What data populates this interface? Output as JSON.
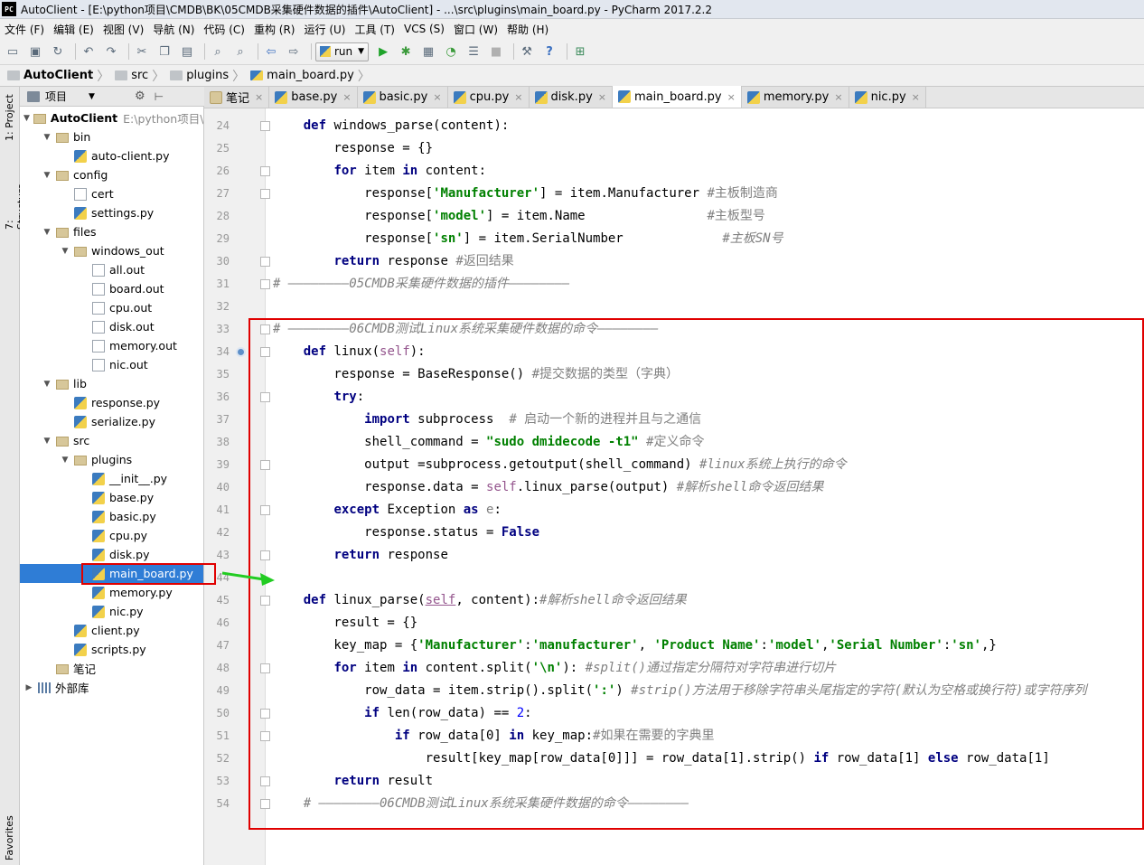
{
  "window": {
    "app_icon": "PC",
    "title": "AutoClient - [E:\\python项目\\CMDB\\BK\\05CMDB采集硬件数据的插件\\AutoClient] - ...\\src\\plugins\\main_board.py - PyCharm 2017.2.2"
  },
  "menu": [
    "文件 (F)",
    "编辑 (E)",
    "视图 (V)",
    "导航 (N)",
    "代码 (C)",
    "重构 (R)",
    "运行 (U)",
    "工具 (T)",
    "VCS (S)",
    "窗口 (W)",
    "帮助 (H)"
  ],
  "toolbar": {
    "run_config": "run",
    "icons": [
      "open-icon",
      "save-icon",
      "sync-icon",
      "undo-icon",
      "redo-icon",
      "cut-icon",
      "copy-icon",
      "paste-icon",
      "find-icon",
      "replace-icon",
      "back-icon",
      "forward-icon",
      "run-icon",
      "debug-icon",
      "coverage-icon",
      "profile-icon",
      "concurrency-icon",
      "stop-icon",
      "settings-icon",
      "help-icon",
      "vcs-icon"
    ]
  },
  "breadcrumb": [
    "AutoClient",
    "src",
    "plugins",
    "main_board.py"
  ],
  "side_tabs": {
    "project": "1: Project",
    "structure": "7: Structure",
    "favorites": "Favorites"
  },
  "project_panel": {
    "title": "项目"
  },
  "tree": [
    {
      "label": "AutoClient",
      "extra": "E:\\python项目\\C",
      "depth": 0,
      "icon": "folder",
      "twisty": "open",
      "bold": true
    },
    {
      "label": "bin",
      "depth": 1,
      "icon": "folder",
      "twisty": "open"
    },
    {
      "label": "auto-client.py",
      "depth": 2,
      "icon": "py"
    },
    {
      "label": "config",
      "depth": 1,
      "icon": "folder",
      "twisty": "open"
    },
    {
      "label": "cert",
      "depth": 2,
      "icon": "file"
    },
    {
      "label": "settings.py",
      "depth": 2,
      "icon": "py"
    },
    {
      "label": "files",
      "depth": 1,
      "icon": "folder",
      "twisty": "open"
    },
    {
      "label": "windows_out",
      "depth": 2,
      "icon": "folder",
      "twisty": "open"
    },
    {
      "label": "all.out",
      "depth": 3,
      "icon": "file"
    },
    {
      "label": "board.out",
      "depth": 3,
      "icon": "file"
    },
    {
      "label": "cpu.out",
      "depth": 3,
      "icon": "file"
    },
    {
      "label": "disk.out",
      "depth": 3,
      "icon": "file"
    },
    {
      "label": "memory.out",
      "depth": 3,
      "icon": "file"
    },
    {
      "label": "nic.out",
      "depth": 3,
      "icon": "file"
    },
    {
      "label": "lib",
      "depth": 1,
      "icon": "folder",
      "twisty": "open"
    },
    {
      "label": "response.py",
      "depth": 2,
      "icon": "py"
    },
    {
      "label": "serialize.py",
      "depth": 2,
      "icon": "py"
    },
    {
      "label": "src",
      "depth": 1,
      "icon": "folder",
      "twisty": "open"
    },
    {
      "label": "plugins",
      "depth": 2,
      "icon": "folder",
      "twisty": "open"
    },
    {
      "label": "__init__.py",
      "depth": 3,
      "icon": "py"
    },
    {
      "label": "base.py",
      "depth": 3,
      "icon": "py"
    },
    {
      "label": "basic.py",
      "depth": 3,
      "icon": "py"
    },
    {
      "label": "cpu.py",
      "depth": 3,
      "icon": "py"
    },
    {
      "label": "disk.py",
      "depth": 3,
      "icon": "py"
    },
    {
      "label": "main_board.py",
      "depth": 3,
      "icon": "py",
      "selected": true
    },
    {
      "label": "memory.py",
      "depth": 3,
      "icon": "py"
    },
    {
      "label": "nic.py",
      "depth": 3,
      "icon": "py"
    },
    {
      "label": "client.py",
      "depth": 2,
      "icon": "py"
    },
    {
      "label": "scripts.py",
      "depth": 2,
      "icon": "py"
    },
    {
      "label": "笔记",
      "depth": 1,
      "icon": "folder"
    },
    {
      "label": "外部库",
      "depth": 0,
      "icon": "lib",
      "twisty": "closed"
    }
  ],
  "tabs": [
    {
      "label": "笔记",
      "icon": "note"
    },
    {
      "label": "base.py"
    },
    {
      "label": "basic.py"
    },
    {
      "label": "cpu.py"
    },
    {
      "label": "disk.py"
    },
    {
      "label": "main_board.py",
      "active": true
    },
    {
      "label": "memory.py"
    },
    {
      "label": "nic.py"
    }
  ],
  "code": {
    "first_line": 24,
    "lines": [
      [
        [
          "    ",
          ""
        ],
        [
          "def",
          "kw"
        ],
        [
          " windows_parse(content):",
          "fn"
        ]
      ],
      [
        [
          "        response = {}",
          ""
        ]
      ],
      [
        [
          "        ",
          ""
        ],
        [
          "for",
          "kw"
        ],
        [
          " item ",
          ""
        ],
        [
          "in",
          "kw"
        ],
        [
          " content:",
          ""
        ]
      ],
      [
        [
          "            response[",
          ""
        ],
        [
          "'Manufacturer'",
          "str"
        ],
        [
          "] = item.Manufacturer ",
          ""
        ],
        [
          "#主板制造商",
          "cmz"
        ]
      ],
      [
        [
          "            response[",
          ""
        ],
        [
          "'model'",
          "str"
        ],
        [
          "] = item.Name                ",
          ""
        ],
        [
          "#主板型号",
          "cmz"
        ]
      ],
      [
        [
          "            response[",
          ""
        ],
        [
          "'sn'",
          "str"
        ],
        [
          "] = item.SerialNumber             ",
          ""
        ],
        [
          "#主板SN号",
          "cm"
        ]
      ],
      [
        [
          "        ",
          ""
        ],
        [
          "return",
          "kw"
        ],
        [
          " response ",
          ""
        ],
        [
          "#返回结果",
          "cmz"
        ]
      ],
      [
        [
          "# ————————05CMDB采集硬件数据的插件————————",
          "cm"
        ]
      ],
      [
        [
          "",
          ""
        ]
      ],
      [
        [
          "# ————————06CMDB测试Linux系统采集硬件数据的命令————————",
          "cm"
        ]
      ],
      [
        [
          "    ",
          ""
        ],
        [
          "def",
          "kw"
        ],
        [
          " linux(",
          ""
        ],
        [
          "self",
          "sf"
        ],
        [
          "):",
          ""
        ]
      ],
      [
        [
          "        response = BaseResponse() ",
          ""
        ],
        [
          "#提交数据的类型（字典）",
          "cmz"
        ]
      ],
      [
        [
          "        ",
          ""
        ],
        [
          "try",
          "kw"
        ],
        [
          ":",
          ""
        ]
      ],
      [
        [
          "            ",
          ""
        ],
        [
          "import",
          "kw"
        ],
        [
          " subprocess  ",
          ""
        ],
        [
          "# 启动一个新的进程并且与之通信",
          "cmz"
        ]
      ],
      [
        [
          "            shell_command = ",
          ""
        ],
        [
          "\"sudo dmidecode -t1\"",
          "str"
        ],
        [
          " ",
          ""
        ],
        [
          "#定义命令",
          "cmz"
        ]
      ],
      [
        [
          "            output =subprocess.getoutput(shell_command) ",
          ""
        ],
        [
          "#linux系统上执行的命令",
          "cm"
        ]
      ],
      [
        [
          "            response.data = ",
          ""
        ],
        [
          "self",
          "sf"
        ],
        [
          ".linux_parse(output) ",
          ""
        ],
        [
          "#解析shell命令返回结果",
          "cm"
        ]
      ],
      [
        [
          "        ",
          ""
        ],
        [
          "except",
          "kw"
        ],
        [
          " Exception ",
          ""
        ],
        [
          "as",
          "kw"
        ],
        [
          " ",
          ""
        ],
        [
          "e",
          "cmz"
        ],
        [
          ":",
          ""
        ]
      ],
      [
        [
          "            response.status = ",
          ""
        ],
        [
          "False",
          "kw"
        ]
      ],
      [
        [
          "        ",
          ""
        ],
        [
          "return",
          "kw"
        ],
        [
          " response",
          ""
        ]
      ],
      [
        [
          "",
          ""
        ]
      ],
      [
        [
          "    ",
          ""
        ],
        [
          "def",
          "kw"
        ],
        [
          " linux_parse(",
          ""
        ],
        [
          "self",
          "sf ul"
        ],
        [
          ", content):",
          ""
        ],
        [
          "#解析shell命令返回结果",
          "cm"
        ]
      ],
      [
        [
          "        result = {}",
          ""
        ]
      ],
      [
        [
          "        key_map = {",
          ""
        ],
        [
          "'Manufacturer'",
          "str"
        ],
        [
          ":",
          ""
        ],
        [
          "'manufacturer'",
          "str"
        ],
        [
          ", ",
          ""
        ],
        [
          "'Product Name'",
          "str"
        ],
        [
          ":",
          ""
        ],
        [
          "'model'",
          "str"
        ],
        [
          ",",
          ""
        ],
        [
          "'Serial Number'",
          "str"
        ],
        [
          ":",
          ""
        ],
        [
          "'sn'",
          "str"
        ],
        [
          ",}",
          ""
        ]
      ],
      [
        [
          "        ",
          ""
        ],
        [
          "for",
          "kw"
        ],
        [
          " item ",
          ""
        ],
        [
          "in",
          "kw"
        ],
        [
          " content.split(",
          ""
        ],
        [
          "'\\n'",
          "str"
        ],
        [
          "): ",
          ""
        ],
        [
          "#split()通过指定分隔符对字符串进行切片",
          "cm"
        ]
      ],
      [
        [
          "            row_data = item.strip().split(",
          ""
        ],
        [
          "':'",
          "str"
        ],
        [
          ") ",
          ""
        ],
        [
          "#strip()方法用于移除字符串头尾指定的字符(默认为空格或换行符)或字符序列",
          "cm"
        ]
      ],
      [
        [
          "            ",
          ""
        ],
        [
          "if",
          "kw"
        ],
        [
          " len(row_data) == ",
          ""
        ],
        [
          "2",
          "num"
        ],
        [
          ":",
          ""
        ]
      ],
      [
        [
          "                ",
          ""
        ],
        [
          "if",
          "kw"
        ],
        [
          " row_data[0] ",
          ""
        ],
        [
          "in",
          "kw"
        ],
        [
          " key_map:",
          ""
        ],
        [
          "#如果在需要的字典里",
          "cmz"
        ]
      ],
      [
        [
          "                    result[key_map[row_data[0]]] = row_data[1].strip() ",
          ""
        ],
        [
          "if",
          "kw"
        ],
        [
          " row_data[1] ",
          ""
        ],
        [
          "else",
          "kw"
        ],
        [
          " row_data[1]",
          ""
        ]
      ],
      [
        [
          "        ",
          ""
        ],
        [
          "return",
          "kw"
        ],
        [
          " result",
          ""
        ]
      ],
      [
        [
          "    ",
          ""
        ],
        [
          "# ————————06CMDB测试Linux系统采集硬件数据的命令————————",
          "cm"
        ]
      ]
    ]
  },
  "colors": {
    "highlight_box": "#e00000",
    "arrow": "#22cc22",
    "selection": "#2f7dd6"
  }
}
